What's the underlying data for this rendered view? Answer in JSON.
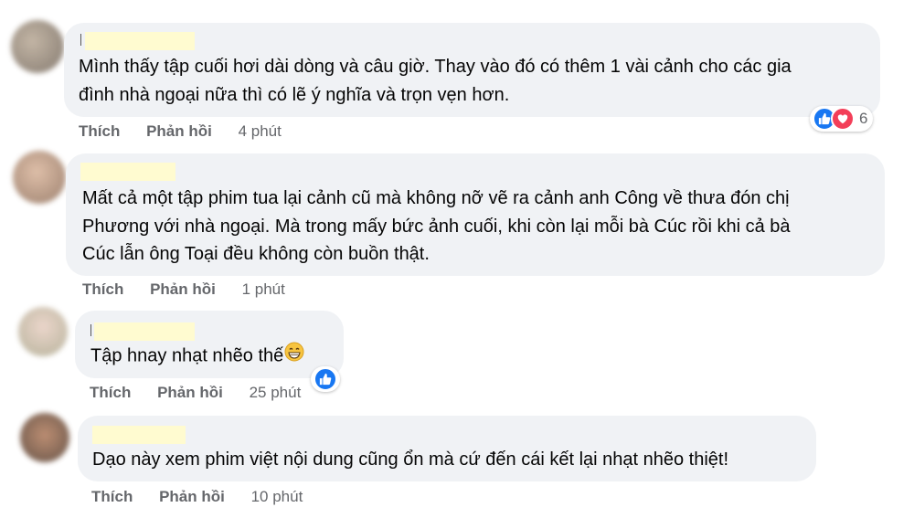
{
  "comments": [
    {
      "lines": [
        "Mình thấy tập cuối hơi dài dòng và câu giờ. Thay vào đó có thêm 1 vài cảnh cho các gia",
        "đình nhà ngoại nữa thì có lẽ ý nghĩa và trọn vẹn hơn."
      ],
      "like_label": "Thích",
      "reply_label": "Phản hồi",
      "time": "4 phút",
      "reaction_count": "6",
      "avatar_color": "#8a7a6a"
    },
    {
      "lines": [
        "Mất cả một tập phim tua lại cảnh cũ mà không nỡ vẽ ra cảnh anh Công về thưa đón chị",
        "Phương với nhà ngoại. Mà trong mấy bức ảnh cuối, khi còn lại mỗi bà Cúc rồi khi cả bà",
        "Cúc lẫn ông Toại đều không còn buồn thật."
      ],
      "like_label": "Thích",
      "reply_label": "Phản hồi",
      "time": "1 phút",
      "avatar_color": "#b48a6a"
    },
    {
      "lines": [
        "Tập hnay nhạt nhẽo thế"
      ],
      "like_label": "Thích",
      "reply_label": "Phản hồi",
      "time": "25 phút",
      "avatar_color": "#c9a592"
    },
    {
      "lines": [
        "Dạo này xem phim việt nội dung cũng ổn mà cứ đến cái kết lại nhạt nhẽo thiệt!"
      ],
      "like_label": "Thích",
      "reply_label": "Phản hồi",
      "time": "10 phút",
      "avatar_color": "#7a5a4a"
    }
  ],
  "colors": {
    "bubble": "#f0f2f5",
    "like": "#1877f2",
    "love": "#f33e58",
    "meta": "#65676b"
  }
}
